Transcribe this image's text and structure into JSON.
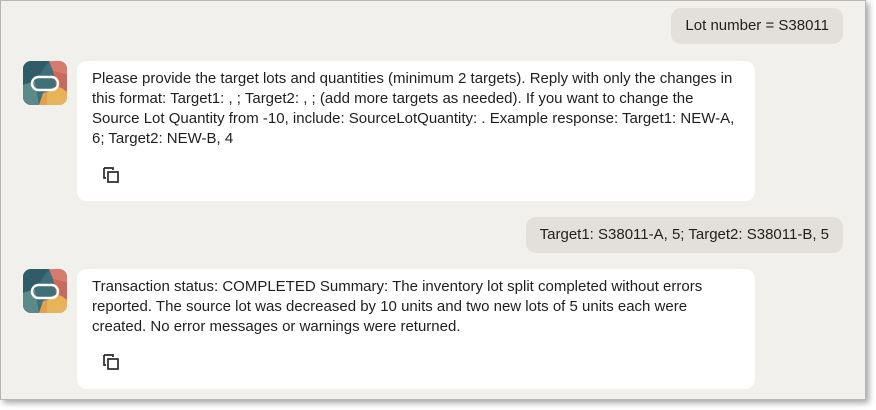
{
  "conversation": {
    "user_message_1": "Lot number = S38011",
    "assistant_message_1": "Please provide the target lots and quantities (minimum 2 targets). Reply with only the changes in this format: Target1: , ; Target2: , ; (add more targets as needed). If you want to change the Source Lot Quantity from -10, include: SourceLotQuantity: . Example response: Target1: NEW-A, 6; Target2: NEW-B, 4",
    "user_message_2": "Target1: S38011-A, 5; Target2: S38011-B, 5",
    "assistant_message_2": "Transaction status: COMPLETED Summary: The inventory lot split completed without errors reported. The source lot was decreased by 10 units and two new lots of 5 units each were created. No error messages or warnings were returned."
  },
  "icons": {
    "assistant_avatar": "oracle-assistant-avatar-icon",
    "copy": "copy-icon"
  },
  "colors": {
    "background": "#f2f0ed",
    "user_bubble": "#e3e0dc",
    "assistant_card": "#ffffff",
    "text": "#1f1f1f"
  }
}
